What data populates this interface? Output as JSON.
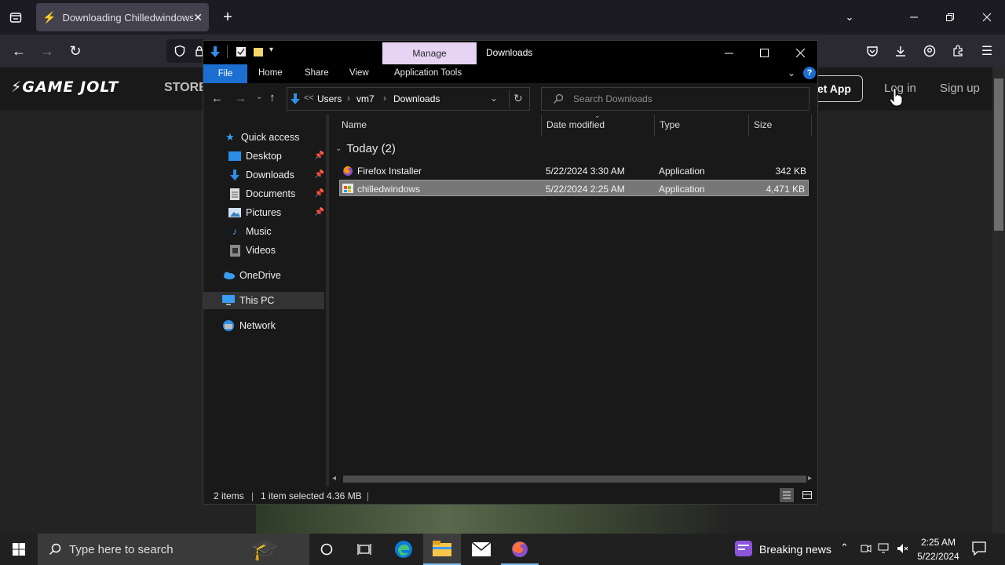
{
  "browser": {
    "tab_title": "Downloading Chilledwindows.e",
    "colors": {
      "tabbar": "#1c1b22",
      "navbar": "#2b2a33"
    }
  },
  "gamejolt": {
    "logo": "GAME JOLT",
    "store": "STORE",
    "get_app": "et App",
    "login": "Log in",
    "signup": "Sign up"
  },
  "explorer": {
    "manage_tab": "Manage",
    "window_title": "Downloads",
    "ribbon": {
      "file": "File",
      "home": "Home",
      "share": "Share",
      "view": "View",
      "app_tools": "Application Tools"
    },
    "address": {
      "crumb_sep": "<<",
      "crumbs": [
        "Users",
        "vm7",
        "Downloads"
      ]
    },
    "search_placeholder": "Search Downloads",
    "nav": {
      "quick_access": "Quick access",
      "desktop": "Desktop",
      "downloads": "Downloads",
      "documents": "Documents",
      "pictures": "Pictures",
      "music": "Music",
      "videos": "Videos",
      "onedrive": "OneDrive",
      "this_pc": "This PC",
      "network": "Network"
    },
    "columns": {
      "name": "Name",
      "date": "Date modified",
      "type": "Type",
      "size": "Size"
    },
    "group": "Today (2)",
    "files": [
      {
        "name": "Firefox Installer",
        "date": "5/22/2024 3:30 AM",
        "type": "Application",
        "size": "342 KB"
      },
      {
        "name": "chilledwindows",
        "date": "5/22/2024 2:25 AM",
        "type": "Application",
        "size": "4,471 KB"
      }
    ],
    "status": {
      "items": "2 items",
      "selected": "1 item selected",
      "size": "4.36 MB"
    }
  },
  "taskbar": {
    "search_placeholder": "Type here to search",
    "news": "Breaking news",
    "time": "2:25 AM",
    "date": "5/22/2024"
  }
}
